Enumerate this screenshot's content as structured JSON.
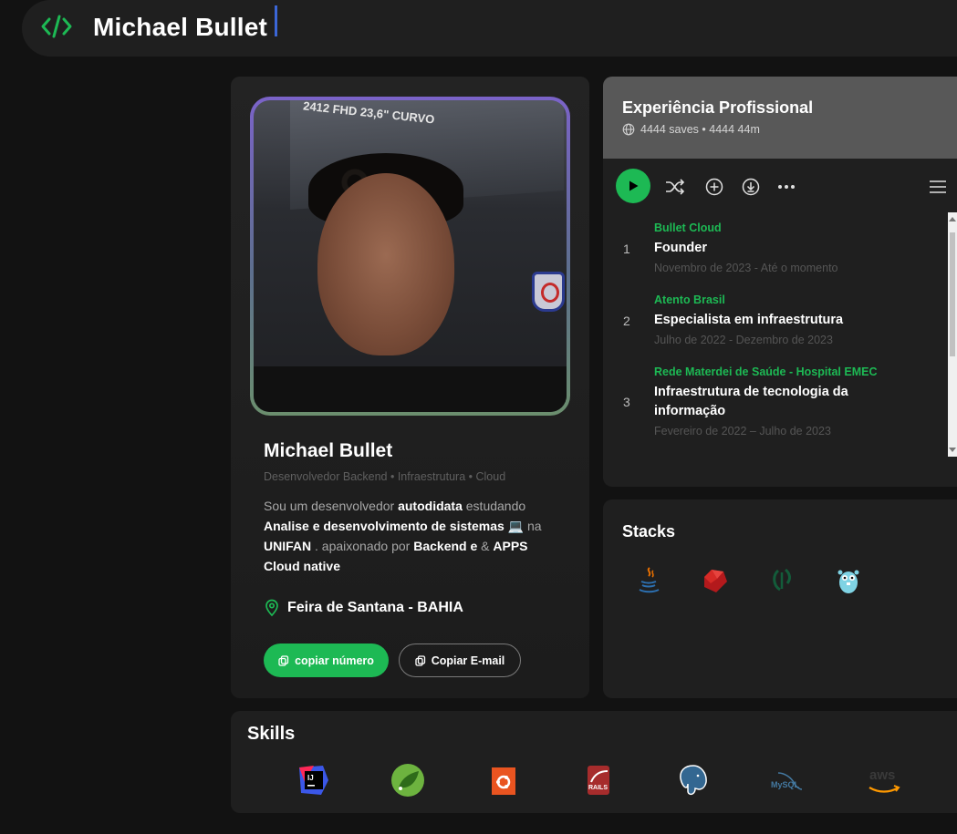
{
  "header": {
    "title": "Michael Bullet",
    "logo_icon": "code-brackets-icon",
    "accent": "#1db954"
  },
  "profile": {
    "name": "Michael Bullet",
    "subtitle": "Desenvolvedor Backend • Infraestrutura • Cloud",
    "bio": {
      "p1": "Sou um desenvolvedor ",
      "b1": "autodidata",
      "p2": " estudando ",
      "b2": "Analise e desenvolvimento de sistemas",
      "emoji": "💻",
      "p3": "  na ",
      "b3": "UNIFAN",
      "p4": " . apaixonado por ",
      "b4": "Backend e",
      "p5": " & ",
      "b5": "APPS Cloud native"
    },
    "location": "Feira de Santana - BAHIA",
    "copy_phone": "copiar número",
    "copy_email": "Copiar E-mail",
    "photo_text": "2412 FHD 23,6\" CURVO"
  },
  "experience": {
    "title": "Experiência Profissional",
    "meta": "4444 saves • 4444 44m",
    "items": [
      {
        "n": "1",
        "company": "Bullet Cloud",
        "role": "Founder",
        "period": "Novembro de 2023 - Até o momento"
      },
      {
        "n": "2",
        "company": "Atento Brasil",
        "role": "Especialista em infraestrutura",
        "period": "Julho de 2022 - Dezembro de 2023"
      },
      {
        "n": "3",
        "company": "Rede Materdei de Saúde - Hospital EMEC",
        "role": "Infraestrutura de tecnologia da informação",
        "period": "Fevereiro de 2022 – Julho de 2023"
      }
    ]
  },
  "stacks": {
    "title": "Stacks",
    "icons": [
      "java-icon",
      "ruby-icon",
      "spring-icon",
      "go-gopher-icon"
    ]
  },
  "skills": {
    "title": "Skills",
    "icons": [
      "intellij-icon",
      "spring-boot-icon",
      "ubuntu-icon",
      "rails-icon",
      "postgresql-icon",
      "mysql-icon",
      "aws-icon"
    ],
    "mysql_label": "MySQL",
    "aws_label": "aws",
    "rails_label": "RAILS"
  }
}
